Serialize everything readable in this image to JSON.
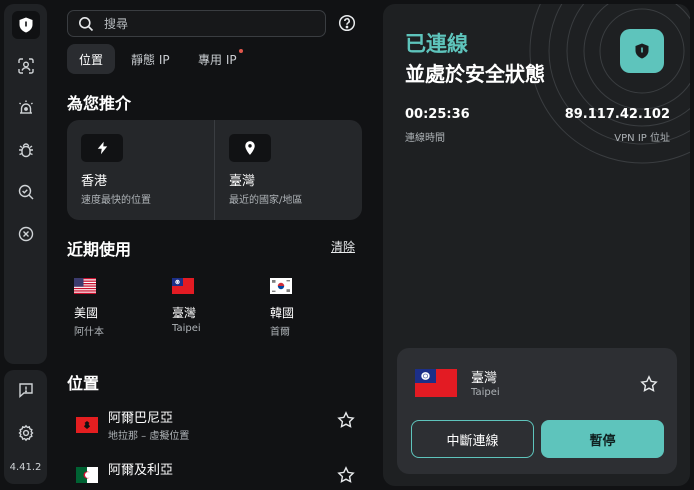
{
  "app": {
    "version": "4.41.2"
  },
  "colors": {
    "accent": "#5ec4bc",
    "background": "#111214",
    "card": "#25272a",
    "notification_dot": "#e2574c"
  },
  "sidebar": {
    "items": [
      {
        "icon": "shield-icon",
        "active": true
      },
      {
        "icon": "face-scan-icon",
        "active": false
      },
      {
        "icon": "alarm-icon",
        "active": false
      },
      {
        "icon": "bug-icon",
        "active": false
      },
      {
        "icon": "magnify-check-icon",
        "active": false
      },
      {
        "icon": "close-circle-icon",
        "active": false
      }
    ],
    "bottom": [
      {
        "icon": "chat-alert-icon"
      },
      {
        "icon": "gear-icon"
      }
    ]
  },
  "search": {
    "placeholder": "搜尋",
    "value": ""
  },
  "tabs": [
    {
      "label": "位置",
      "active": true
    },
    {
      "label": "靜態 IP",
      "active": false
    },
    {
      "label": "專用 IP",
      "active": false,
      "badge": true
    }
  ],
  "recommended": {
    "title": "為您推介",
    "items": [
      {
        "icon": "lightning-icon",
        "name": "香港",
        "sub": "速度最快的位置"
      },
      {
        "icon": "location-pin-icon",
        "name": "臺灣",
        "sub": "最近的國家/地區"
      }
    ]
  },
  "recent": {
    "title": "近期使用",
    "clear_label": "清除",
    "items": [
      {
        "flag": "us-flag-icon",
        "name": "美國",
        "sub": "阿什本"
      },
      {
        "flag": "taiwan-flag-icon",
        "name": "臺灣",
        "sub": "Taipei"
      },
      {
        "flag": "korea-flag-icon",
        "name": "韓國",
        "sub": "首爾"
      }
    ]
  },
  "locations": {
    "title": "位置",
    "items": [
      {
        "flag": "albania-flag-icon",
        "name": "阿爾巴尼亞",
        "sub": "地拉那 – 虛擬位置"
      },
      {
        "flag": "algeria-flag-icon",
        "name": "阿爾及利亞",
        "sub": ""
      }
    ]
  },
  "connection": {
    "status_line1": "已連線",
    "status_line2": "並處於安全狀態",
    "duration": "00:25:36",
    "duration_label": "連線時間",
    "ip": "89.117.42.102",
    "ip_label": "VPN IP 位址",
    "current": {
      "flag": "taiwan-flag-icon",
      "name": "臺灣",
      "sub": "Taipei"
    },
    "disconnect_label": "中斷連線",
    "pause_label": "暫停"
  }
}
